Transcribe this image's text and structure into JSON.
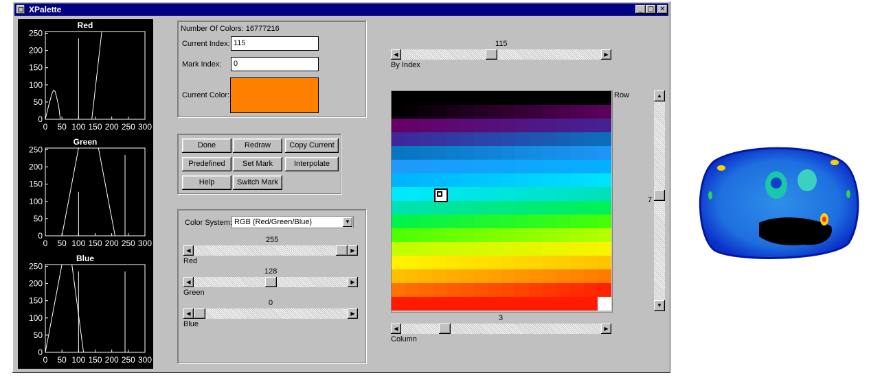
{
  "window": {
    "title": "XPalette",
    "minimize_glyph": "_",
    "maximize_glyph": "□",
    "close_glyph": "✕"
  },
  "plots": [
    {
      "title": "Red",
      "color": "#ffffff",
      "yticks": [
        "250",
        "200",
        "150",
        "100",
        "50",
        "0"
      ],
      "xticks": [
        "0",
        "50",
        "100",
        "150",
        "200",
        "250",
        "300"
      ],
      "curve": [
        [
          0,
          0
        ],
        [
          10,
          40
        ],
        [
          20,
          75
        ],
        [
          25,
          85
        ],
        [
          30,
          80
        ],
        [
          40,
          40
        ],
        [
          45,
          0
        ],
        [
          125,
          0
        ],
        [
          140,
          0
        ],
        [
          170,
          255
        ],
        [
          200,
          255
        ],
        [
          240,
          255
        ],
        [
          255,
          255
        ]
      ],
      "mark_x": 100
    },
    {
      "title": "Green",
      "color": "#ffffff",
      "yticks": [
        "250",
        "200",
        "150",
        "100",
        "50",
        "0"
      ],
      "xticks": [
        "0",
        "50",
        "100",
        "150",
        "200",
        "250",
        "300"
      ],
      "curve": [
        [
          0,
          0
        ],
        [
          50,
          0
        ],
        [
          100,
          255
        ],
        [
          160,
          255
        ],
        [
          210,
          0
        ],
        [
          230,
          0
        ],
        [
          255,
          0
        ]
      ],
      "mark_x": 100,
      "mark_top": 128,
      "mark2_x": 240
    },
    {
      "title": "Blue",
      "color": "#ffffff",
      "yticks": [
        "250",
        "200",
        "150",
        "100",
        "50",
        "0"
      ],
      "xticks": [
        "0",
        "50",
        "100",
        "150",
        "200",
        "250",
        "300"
      ],
      "curve": [
        [
          0,
          0
        ],
        [
          50,
          255
        ],
        [
          80,
          255
        ],
        [
          115,
          0
        ],
        [
          255,
          0
        ]
      ],
      "mark_x": 100,
      "mark2_x": 240
    }
  ],
  "info": {
    "num_colors_label": "Number Of Colors: 16777216",
    "current_index_label": "Current Index:",
    "current_index_value": "115",
    "mark_index_label": "Mark Index:",
    "mark_index_value": "0",
    "current_color_label": "Current Color:",
    "current_color": "#ff8000"
  },
  "buttons": {
    "done": "Done",
    "redraw": "Redraw",
    "copy_current": "Copy Current",
    "predefined": "Predefined",
    "set_mark": "Set Mark",
    "interpolate": "Interpolate",
    "help": "Help",
    "switch_mark": "Switch Mark"
  },
  "color_system": {
    "label": "Color System:",
    "selected": "RGB  (Red/Green/Blue)",
    "red_value": "255",
    "red_label": "Red",
    "red_fraction": 1.0,
    "green_value": "128",
    "green_label": "Green",
    "green_fraction": 0.5,
    "blue_value": "0",
    "blue_label": "Blue",
    "blue_fraction": 0.0
  },
  "palette": {
    "by_index_value": "115",
    "by_index_label": "By Index",
    "by_index_fraction": 0.45,
    "row_label": "Row",
    "row_value": "7",
    "row_fraction": 0.47,
    "column_value": "3",
    "column_label": "Column",
    "column_fraction": 0.2,
    "marked_cell": {
      "row": 7,
      "col": 3
    },
    "rows": 16,
    "cols": 16
  }
}
